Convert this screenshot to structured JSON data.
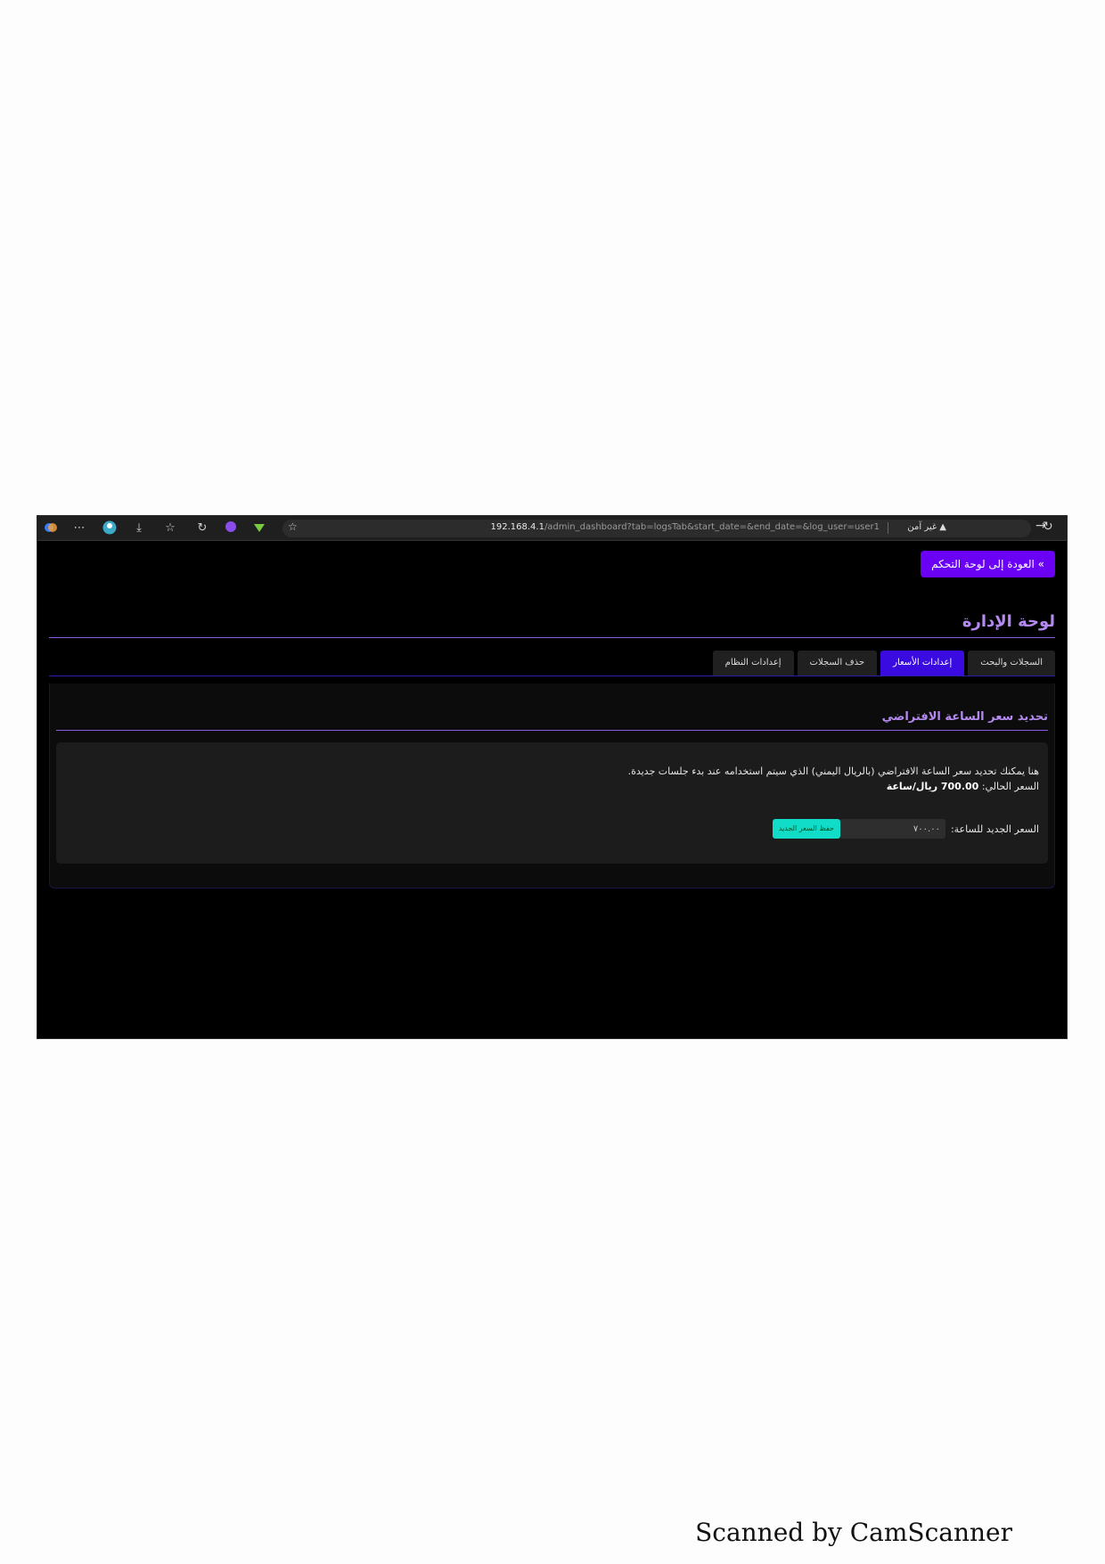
{
  "browser": {
    "url_host": "192.168.4.1",
    "url_path": "/admin_dashboard?tab=logsTab&start_date=&end_date=&log_user=user1",
    "security_label": "غير آمن"
  },
  "page": {
    "back_button": "» العودة إلى لوحة التحكم",
    "title": "لوحة الإدارة",
    "tabs": [
      {
        "label": "السجلات والبحث"
      },
      {
        "label": "إعدادات الأسعار"
      },
      {
        "label": "حذف السجلات"
      },
      {
        "label": "إعدادات النظام"
      }
    ],
    "section": {
      "title": "تحديد سعر الساعة الافتراضي",
      "description": "هنا يمكنك تحديد سعر الساعة الافتراضي (بالريال اليمني) الذي سيتم استخدامه عند بدء جلسات جديدة.",
      "current_price_label": "السعر الحالي:",
      "current_price_value": "700.00 ريال/ساعة",
      "new_price_label": "السعر الجديد للساعة:",
      "new_price_value": "٧٠٠.٠٠",
      "save_button": "حفظ السعر الجديد"
    }
  },
  "footer": {
    "scanner_text": "Scanned by CamScanner"
  },
  "colors": {
    "accent": "#6a00f4",
    "active_tab": "#3a0be0",
    "heading": "#b58af0",
    "save_button": "#11dcc8"
  }
}
